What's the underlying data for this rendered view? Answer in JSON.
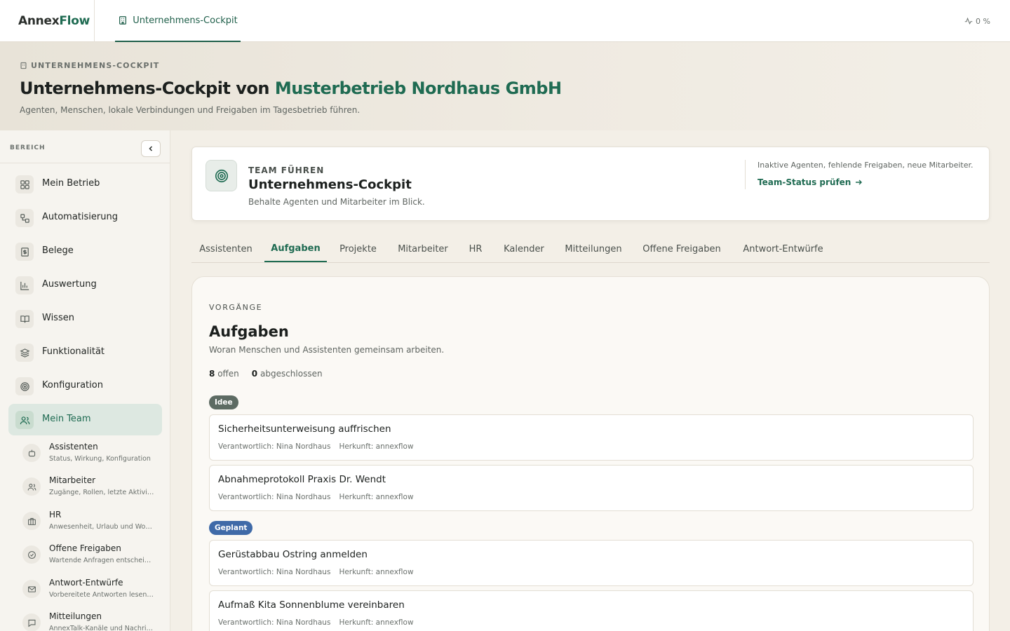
{
  "app": {
    "logo_part1": "Annex",
    "logo_part2": "Flow"
  },
  "topbar": {
    "tab_label": "Unternehmens-Cockpit",
    "metric": "0 %"
  },
  "hero": {
    "kicker": "UNTERNEHMENS-COCKPIT",
    "title_prefix": "Unternehmens-Cockpit von ",
    "company": "Musterbetrieb Nordhaus GmbH",
    "subtitle": "Agenten, Menschen, lokale Verbindungen und Freigaben im Tagesbetrieb führen."
  },
  "sidebar": {
    "header": "BEREICH",
    "items": [
      {
        "label": "Mein Betrieb",
        "icon": "grid-icon"
      },
      {
        "label": "Automatisierung",
        "icon": "workflow-icon"
      },
      {
        "label": "Belege",
        "icon": "receipt-icon"
      },
      {
        "label": "Auswertung",
        "icon": "chart-icon"
      },
      {
        "label": "Wissen",
        "icon": "book-icon"
      },
      {
        "label": "Funktionalität",
        "icon": "layers-icon"
      },
      {
        "label": "Konfiguration",
        "icon": "target-icon"
      },
      {
        "label": "Mein Team",
        "icon": "users-icon"
      }
    ],
    "subitems": [
      {
        "title": "Assistenten",
        "desc": "Status, Wirkung, Konfiguration",
        "icon": "bot-icon"
      },
      {
        "title": "Mitarbeiter",
        "desc": "Zugänge, Rollen, letzte Aktivität",
        "icon": "users-icon"
      },
      {
        "title": "HR",
        "desc": "Anwesenheit, Urlaub und Wor…",
        "icon": "briefcase-icon"
      },
      {
        "title": "Offene Freigaben",
        "desc": "Wartende Anfragen entscheid…",
        "icon": "check-circle-icon"
      },
      {
        "title": "Antwort-Entwürfe",
        "desc": "Vorbereitete Antworten lesen …",
        "icon": "mail-icon"
      },
      {
        "title": "Mitteilungen",
        "desc": "AnnexTalk-Kanäle und Nachri…",
        "icon": "message-icon"
      }
    ]
  },
  "team_card": {
    "kicker": "TEAM FÜHREN",
    "title": "Unternehmens-Cockpit",
    "subtitle": "Behalte Agenten und Mitarbeiter im Blick.",
    "note": "Inaktive Agenten, fehlende Freigaben, neue Mitarbeiter.",
    "link": "Team-Status prüfen"
  },
  "tabs": [
    "Assistenten",
    "Aufgaben",
    "Projekte",
    "Mitarbeiter",
    "HR",
    "Kalender",
    "Mitteilungen",
    "Offene Freigaben",
    "Antwort-Entwürfe"
  ],
  "active_tab": "Aufgaben",
  "tasks": {
    "kicker": "VORGÄNGE",
    "title": "Aufgaben",
    "subtitle": "Woran Menschen und Assistenten gemeinsam arbeiten.",
    "open_count": "8",
    "open_label": "offen",
    "done_count": "0",
    "done_label": "abgeschlossen",
    "groups": [
      {
        "status": "Idee",
        "color": "#5d6b63",
        "items": [
          {
            "title": "Sicherheitsunterweisung auffrischen",
            "owner": "Verantwortlich: Nina Nordhaus",
            "origin": "Herkunft: annexflow"
          },
          {
            "title": "Abnahmeprotokoll Praxis Dr. Wendt",
            "owner": "Verantwortlich: Nina Nordhaus",
            "origin": "Herkunft: annexflow"
          }
        ]
      },
      {
        "status": "Geplant",
        "color": "#3f6aa8",
        "items": [
          {
            "title": "Gerüstabbau Ostring anmelden",
            "owner": "Verantwortlich: Nina Nordhaus",
            "origin": "Herkunft: annexflow"
          },
          {
            "title": "Aufmaß Kita Sonnenblume vereinbaren",
            "owner": "Verantwortlich: Nina Nordhaus",
            "origin": "Herkunft: annexflow"
          }
        ]
      }
    ]
  },
  "colors": {
    "accent": "#1f6b52",
    "idee": "#5d6b63",
    "geplant": "#3f6aa8"
  }
}
